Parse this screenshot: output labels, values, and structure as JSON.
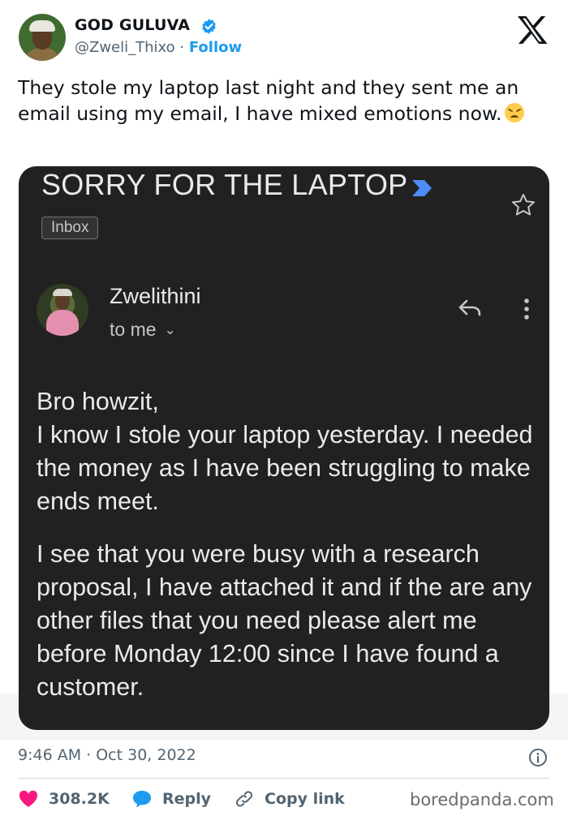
{
  "header": {
    "display_name": "GOD GULUVA",
    "handle": "@Zweli_Thixo",
    "separator": "·",
    "follow_label": "Follow"
  },
  "tweet": {
    "text": "They stole my laptop last night and they sent me an email using my email, I have mixed emotions now."
  },
  "email": {
    "subject": "SORRY FOR THE LAPTOP",
    "label": "Inbox",
    "sender_name": "Zwelithini",
    "recipient": "to me",
    "body_paragraphs": [
      "Bro howzit,\nI know I stole your laptop yesterday. I needed the money as I have been struggling to make ends meet.",
      "I see that you were busy with a research proposal, I have attached it and if the are any other files that you need please alert me before Monday 12:00 since I have found a customer."
    ],
    "icons": [
      "star-icon",
      "reply-icon",
      "more-vert-icon",
      "chevron-down-icon",
      "importance-arrow-icon"
    ]
  },
  "footer": {
    "timestamp": "9:46 AM · Oct 30, 2022",
    "like_count": "308.2K",
    "reply_label": "Reply",
    "copy_link_label": "Copy link",
    "watermark": "boredpanda.com"
  },
  "colors": {
    "accent": "#1d9bf0",
    "like": "#f91880",
    "card_bg": "#212121",
    "muted": "#536471"
  }
}
